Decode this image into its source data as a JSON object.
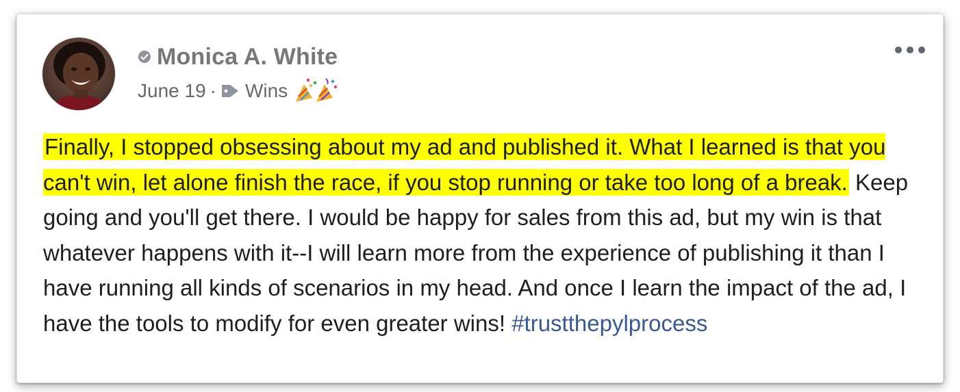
{
  "post": {
    "author": {
      "name": "Monica A. White",
      "avatar_icon": "avatar-photo",
      "status_icon": "gray-circle-check-icon"
    },
    "meta": {
      "date": "June 19",
      "separator": "·",
      "topic_icon": "tag-icon",
      "topic": "Wins",
      "emoji_icon": "party-popper-icon"
    },
    "more_icon": "ellipsis-icon",
    "body": {
      "highlighted_text": "Finally, I stopped obsessing about my ad and published it. What I learned is that you can't win, let alone finish the race, if you stop running or take too long of a break.",
      "rest_text": " Keep going and you'll get there. I would be happy for sales from this ad, but my win is that whatever happens with it--I will learn more from the experience of publishing it than I have running all kinds of scenarios in my head. And once I learn the impact of the ad, I have the tools to modify for even greater wins! ",
      "hashtag": "#trustthepylprocess"
    }
  },
  "colors": {
    "highlight": "#ffff00",
    "hashtag": "#385898",
    "name": "#777777",
    "meta": "#65676b",
    "body_text": "#1c1e21"
  }
}
